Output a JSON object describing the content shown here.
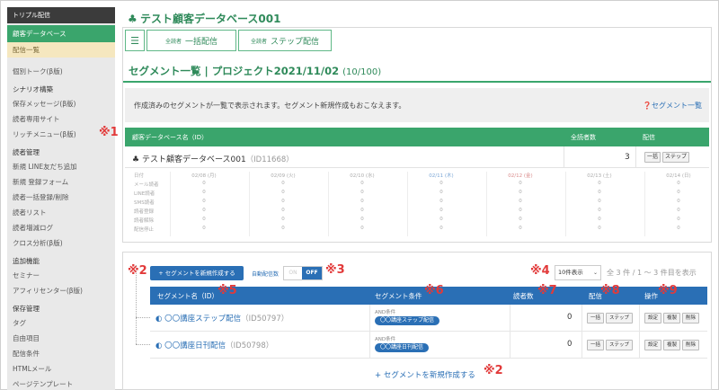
{
  "sidebar": {
    "top": "トリプル配信",
    "active": "顧客データベース",
    "sub": "配信一覧",
    "items1": [
      "個別トーク(β版)"
    ],
    "section1": "シナリオ構築",
    "items2": [
      "保存メッセージ(β版)",
      "読者専用サイト",
      "リッチメニュー(β版)"
    ],
    "section2": "読者管理",
    "items3": [
      "新規 LINE友だち追加",
      "新規 登録フォーム",
      "読者一括登録/削除",
      "読者リスト",
      "読者増減ログ",
      "クロス分析(β版)"
    ],
    "section3": "追加機能",
    "items4": [
      "セミナー",
      "アフィリセンター(β版)"
    ],
    "section4": "保存管理",
    "items5": [
      "タグ",
      "自由項目",
      "配信条件",
      "HTMLメール",
      "ページテンプレート"
    ]
  },
  "main": {
    "db_title": "テスト顧客データベース001",
    "toolbar": {
      "btn1_small": "全読者",
      "btn1": "一括配信",
      "btn2_small": "全読者",
      "btn2": "ステップ配信"
    },
    "segment_title": "セグメント一覧 | プロジェクト2021/11/02",
    "segment_count": "(10/100)",
    "notice": "作成済みのセグメントが一覧で表示されます。セグメント新規作成もおこなえます。",
    "notice_link": "セグメント一覧",
    "db_table": {
      "col_name": "顧客データベース名（ID）",
      "col_total": "全読者数",
      "col_delivery": "配信",
      "row_name": "テスト顧客データベース001",
      "row_id": "（ID11668）",
      "row_total": "3",
      "btn_bulk": "一括",
      "btn_step": "ステップ"
    },
    "stats": {
      "row_labels": [
        "日付",
        "メール読者",
        "LINE読者",
        "SMS読者",
        "読者登録",
        "読者解除",
        "配信停止"
      ],
      "dates": [
        "02/08 (月)",
        "02/09 (火)",
        "02/10 (水)",
        "02/11 (木)",
        "02/12 (金)",
        "02/13 (土)",
        "02/14 (日)"
      ],
      "zero": "0"
    },
    "segments": {
      "new_button": "+ セグメントを新規作成する",
      "auto_label": "自動配信数",
      "toggle_on": "ON",
      "toggle_off": "OFF",
      "per_page": "10件表示",
      "range": "全 3 件 / 1 ～ 3 件目を表示",
      "headers": {
        "name": "セグメント名（ID）",
        "condition": "セグメント条件",
        "readers": "読者数",
        "delivery": "配信",
        "action": "操作"
      },
      "rows": [
        {
          "name": "〇〇講座ステップ配信",
          "id": "（ID50797）",
          "cond_label": "AND条件",
          "cond_pill": "〇〇講座ステップ配信",
          "readers": "0"
        },
        {
          "name": "〇〇講座日刊配信",
          "id": "（ID50798）",
          "cond_label": "AND条件",
          "cond_pill": "〇〇講座日刊配信",
          "readers": "0"
        }
      ],
      "btn_bulk": "一括",
      "btn_step": "ステップ",
      "btn_setting": "設定",
      "btn_copy": "複製",
      "btn_delete": "削除",
      "add_link": "+ セグメントを新規作成する"
    }
  },
  "marks": {
    "m1": "※1",
    "m2": "※2",
    "m3": "※3",
    "m4": "※4",
    "m5": "※5",
    "m6": "※6",
    "m7": "※7",
    "m8": "※8",
    "m9": "※9",
    "m2b": "※2"
  },
  "colors": {
    "green": "#3aa56c",
    "blue": "#2a6fb5",
    "annotation_red": "#e23a3a"
  }
}
